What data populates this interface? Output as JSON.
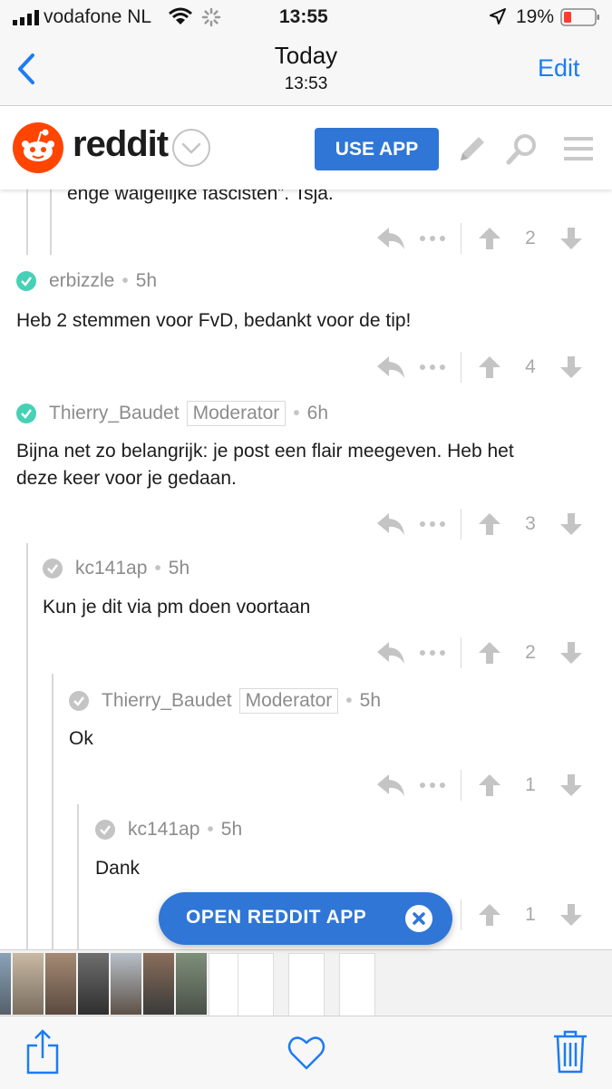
{
  "status_bar": {
    "carrier": "vodafone NL",
    "time": "13:55",
    "battery": "19%"
  },
  "nav": {
    "back_icon": "chevron-left-icon",
    "title": "Today",
    "subtitle": "13:53",
    "edit": "Edit"
  },
  "reddit_header": {
    "logo_text": "reddit",
    "use_app": "USE APP"
  },
  "top_fragment": {
    "text": "enge walgelijke fascisten”. Tsja.",
    "score": "2"
  },
  "comments": [
    {
      "user": "erbizzle",
      "age": "5h",
      "body": "Heb 2 stemmen voor FvD, bedankt voor de tip!",
      "score": "4"
    },
    {
      "user": "Thierry_Baudet",
      "badge": "Moderator",
      "age": "6h",
      "body": [
        "Bijna net zo belangrijk: je post een flair meegeven. Heb het",
        "deze keer voor je gedaan."
      ],
      "score": "3"
    },
    {
      "user": "kc141ap",
      "age": "5h",
      "body": "Kun je dit via pm doen voortaan",
      "score": "2"
    },
    {
      "user": "Thierry_Baudet",
      "badge": "Moderator",
      "age": "5h",
      "body": "Ok",
      "score": "1"
    },
    {
      "user": "kc141ap",
      "age": "5h",
      "body": "Dank",
      "score": "1"
    }
  ],
  "open_app": {
    "label": "OPEN REDDIT APP"
  },
  "colors": {
    "accent_blue": "#2f76d6",
    "ios_blue": "#1d7cf2",
    "reddit_orange": "#ff4500",
    "check_teal": "#46d1b6",
    "check_grey": "#c4c4c4",
    "battery_red": "#ff3b30"
  }
}
